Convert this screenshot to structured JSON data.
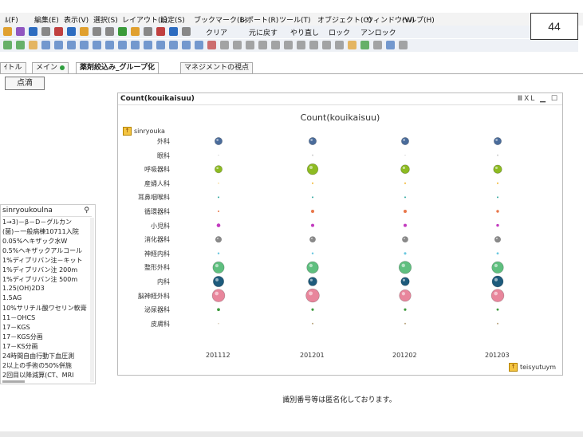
{
  "menu": [
    "ﾙ(F)",
    "編集(E)",
    "表示(V)",
    "選択(S)",
    "レイアウト(L)",
    "設定(S)",
    "ブックマーク(B)",
    "レポート(R)",
    "ツール(T)",
    "オブジェクト(O)",
    "ウィンドウ(W)",
    "ヘルプ(H)"
  ],
  "toolbar": {
    "clear": "クリア",
    "back": "元に戻す",
    "redo": "やり直し",
    "lock": "ロック",
    "unlock": "アンロック"
  },
  "badge": "44",
  "tabs": [
    {
      "label": "ｲトル"
    },
    {
      "label": "メイン"
    },
    {
      "label": "薬剤絞込み_グループ化"
    },
    {
      "label": "マネジメントの視点"
    }
  ],
  "tenteki_button": "点滴",
  "left_panel": {
    "title": "sinryoukoulna",
    "items": [
      "1→3)－β－D－グルカン",
      "(菌)－一般病棟10711入院",
      "0.05%ヘキザック水W",
      "0.5%ヘキザックアルコール",
      "1%ディプリバン注－キット",
      "1%ディプリバン注 200m",
      "1%ディプリバン注 500m",
      "1.25(OH)2D3",
      "1.5AG",
      "10%サリチル酸ワセリン軟膏",
      "11－OHCS",
      "17－KGS",
      "17－KGS分画",
      "17－KS分画",
      "24時間自由行動下血圧測",
      "2以上の手術の50%併施",
      "2回目以降減算(CT、MRI"
    ]
  },
  "chart_window": {
    "title": "Count(kouikaisuu)",
    "controls": "ⅢXL ▁ ☐"
  },
  "chart_data": {
    "type": "scatter",
    "title": "Count(kouikaisuu)",
    "row_dimension": "sinryouka",
    "column_dimension": "teisyutuym",
    "rows": [
      "外科",
      "眼科",
      "呼吸器科",
      "産婦人科",
      "耳鼻咽喉科",
      "循環器科",
      "小児科",
      "消化器科",
      "神経内科",
      "整形外科",
      "内科",
      "脳神経外科",
      "泌尿器科",
      "皮膚科"
    ],
    "columns": [
      "201112",
      "201201",
      "201202",
      "201203"
    ],
    "note": "bubble size encodes count; no numeric labels shown",
    "sizes": [
      [
        3,
        0,
        3,
        0,
        0.5,
        0.6,
        1.5,
        2.4,
        0.8,
        4.6,
        4.3,
        5.1,
        1.2,
        0
      ],
      [
        3,
        0.4,
        4.4,
        0.6,
        0.3,
        1.3,
        1.3,
        2.3,
        0.8,
        4.7,
        3.5,
        5.4,
        1.0,
        0.4
      ],
      [
        3,
        0,
        3.5,
        0.4,
        0.3,
        1.3,
        1.3,
        2.3,
        1.0,
        5.0,
        3.4,
        4.7,
        1.0,
        0.4
      ],
      [
        3,
        0.4,
        3.4,
        0.4,
        0.4,
        1.1,
        1.1,
        2.4,
        0.9,
        4.7,
        4.5,
        5.1,
        0.9,
        0.4
      ]
    ],
    "colors": {
      "外科": "#4a6c9b",
      "眼科": "#cccccc",
      "呼吸器科": "#8dbb22",
      "産婦人科": "#f0b020",
      "耳鼻咽喉科": "#33a9a1",
      "循環器科": "#e8774a",
      "小児科": "#c23bbf",
      "消化器科": "#8a8a8a",
      "神経内科": "#6bc8e0",
      "整形外科": "#5fbf7f",
      "内科": "#1e5b7c",
      "脳神経外科": "#e8869c",
      "泌尿器科": "#3e9a3e",
      "皮膚科": "#b7a27a"
    }
  },
  "footnote": "識別番号等は匿名化しております。"
}
